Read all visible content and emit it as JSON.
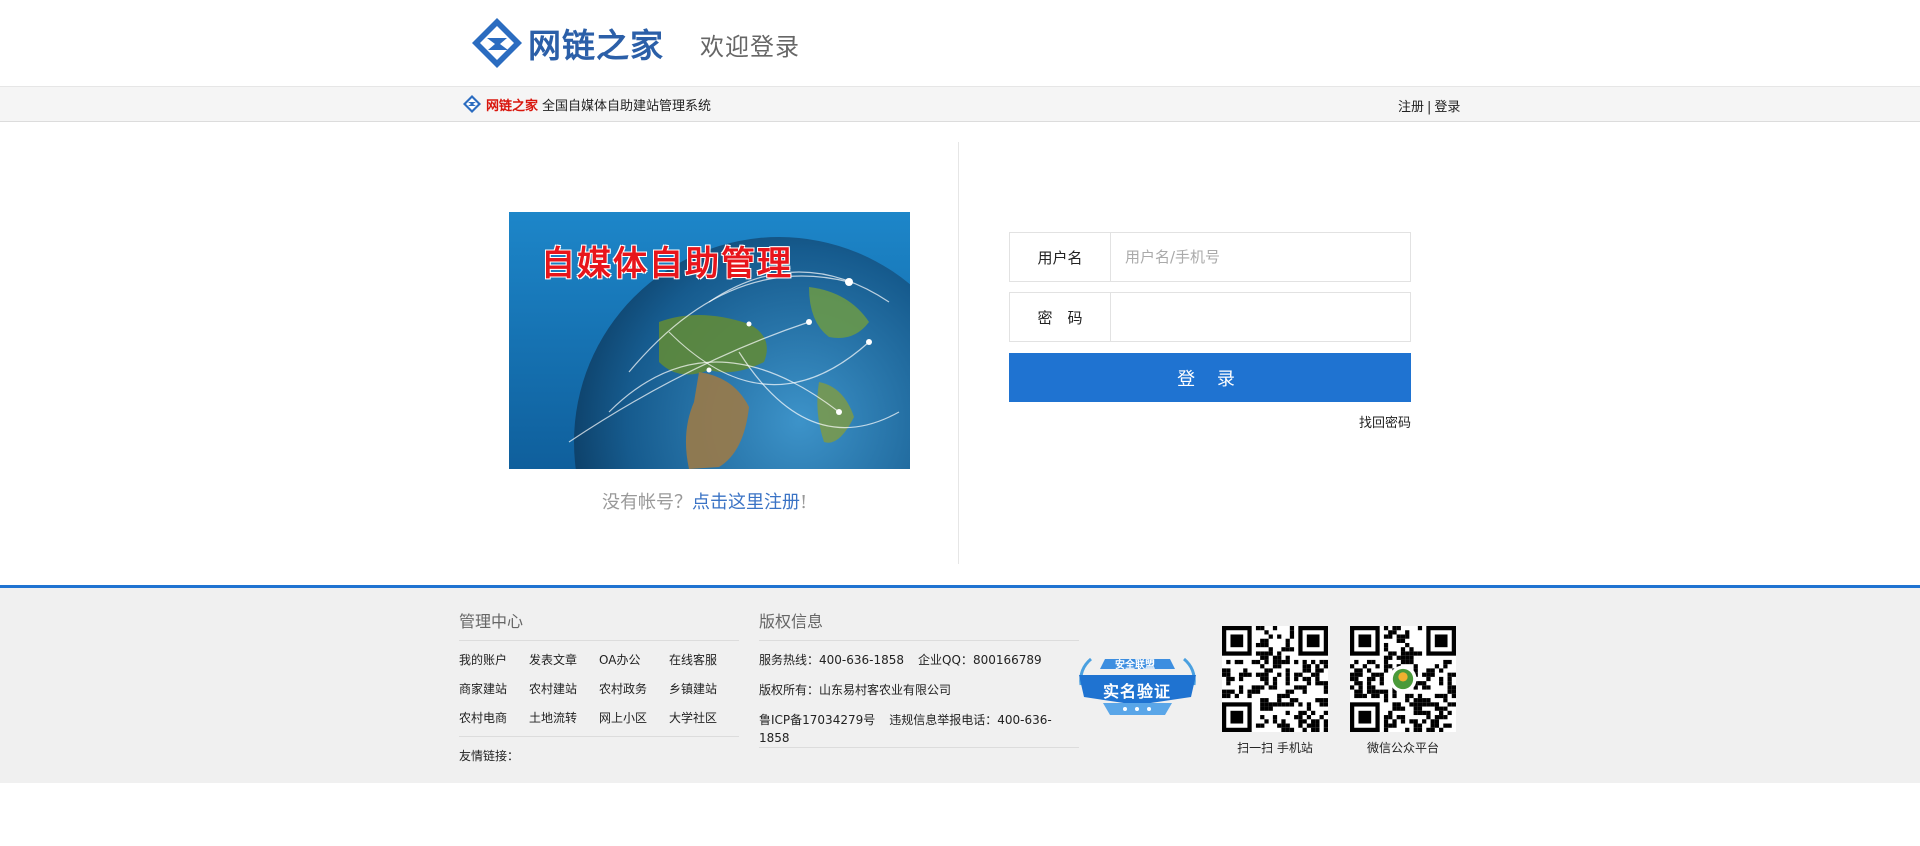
{
  "header": {
    "logo_text": "网链之家",
    "welcome": "欢迎登录"
  },
  "topbar": {
    "brand": "网链之家",
    "description": "全国自媒体自助建站管理系统",
    "register": "注册",
    "separator": "|",
    "login": "登录"
  },
  "banner": {
    "title": "自媒体自助管理"
  },
  "register_hint": {
    "prefix": "没有帐号？",
    "link": "点击这里注册",
    "suffix": "!"
  },
  "form": {
    "username_label": "用户名",
    "username_placeholder": "用户名/手机号",
    "password_label": "密　码",
    "login_button": "登 录",
    "forgot": "找回密码"
  },
  "footer": {
    "management": {
      "heading": "管理中心",
      "links": [
        "我的账户",
        "发表文章",
        "OA办公",
        "在线客服",
        "商家建站",
        "农村建站",
        "农村政务",
        "乡镇建站",
        "农村电商",
        "土地流转",
        "网上小区",
        "大学社区"
      ]
    },
    "friend_links": "友情链接：",
    "copyright": {
      "heading": "版权信息",
      "hotline_label": "服务热线：",
      "hotline": "400-636-1858",
      "qq_label": "企业QQ：",
      "qq": "800166789",
      "owner_label": "版权所有：",
      "owner": "山东易村客农业有限公司",
      "icp": "鲁ICP备17034279号",
      "report_label": "违规信息举报电话：",
      "report": "400-636-1858"
    },
    "badge": {
      "top": "安全联盟",
      "main": "实名验证"
    },
    "qr_mobile_caption": "扫一扫 手机站",
    "qr_wechat_caption": "微信公众平台"
  },
  "colors": {
    "accent": "#1f73d1",
    "brand_blue": "#2b5fa8",
    "brand_red": "#d9160d"
  }
}
